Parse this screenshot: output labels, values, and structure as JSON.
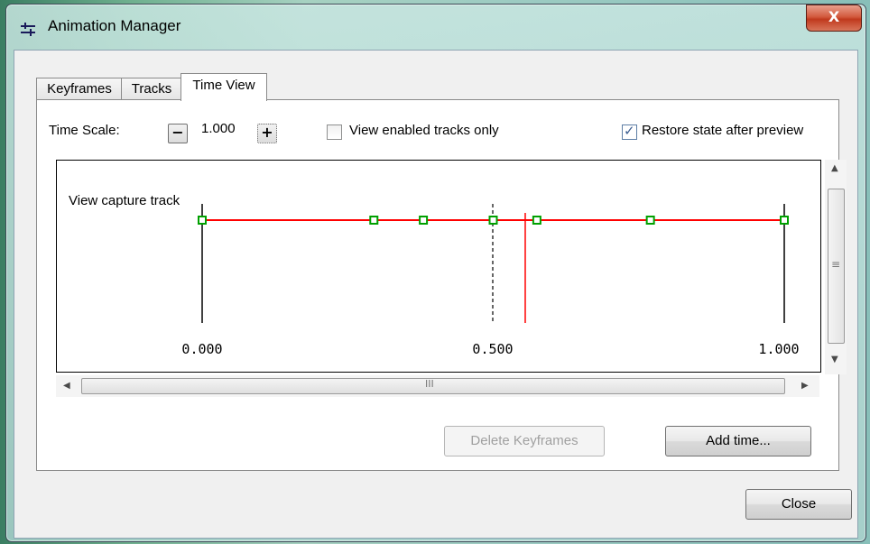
{
  "window": {
    "title": "Animation Manager",
    "close_label": "X"
  },
  "tabs": [
    {
      "label": "Keyframes",
      "active": false
    },
    {
      "label": "Tracks",
      "active": false
    },
    {
      "label": "Time View",
      "active": true
    }
  ],
  "toolbar": {
    "time_scale_label": "Time Scale:",
    "minus_label": "−",
    "scale_value": "1.000",
    "plus_label": "+",
    "view_enabled_label": "View enabled tracks only",
    "view_enabled_checked": false,
    "restore_state_label": "Restore state after preview",
    "restore_state_checked": true
  },
  "timeline": {
    "track_name": "View capture track",
    "track_color": "#ff0000",
    "key_color": "#00a000",
    "tick_labels": [
      "0.000",
      "0.500",
      "1.000"
    ],
    "keyframes": [
      0.0,
      0.295,
      0.38,
      0.5,
      0.575,
      0.77,
      1.0
    ],
    "current_time": 0.555
  },
  "scrollbars": {
    "hscroll_grip": "III",
    "vscroll_grip": "≡"
  },
  "actions": {
    "delete_keyframes_label": "Delete Keyframes",
    "add_time_label": "Add time...",
    "close_label": "Close"
  }
}
